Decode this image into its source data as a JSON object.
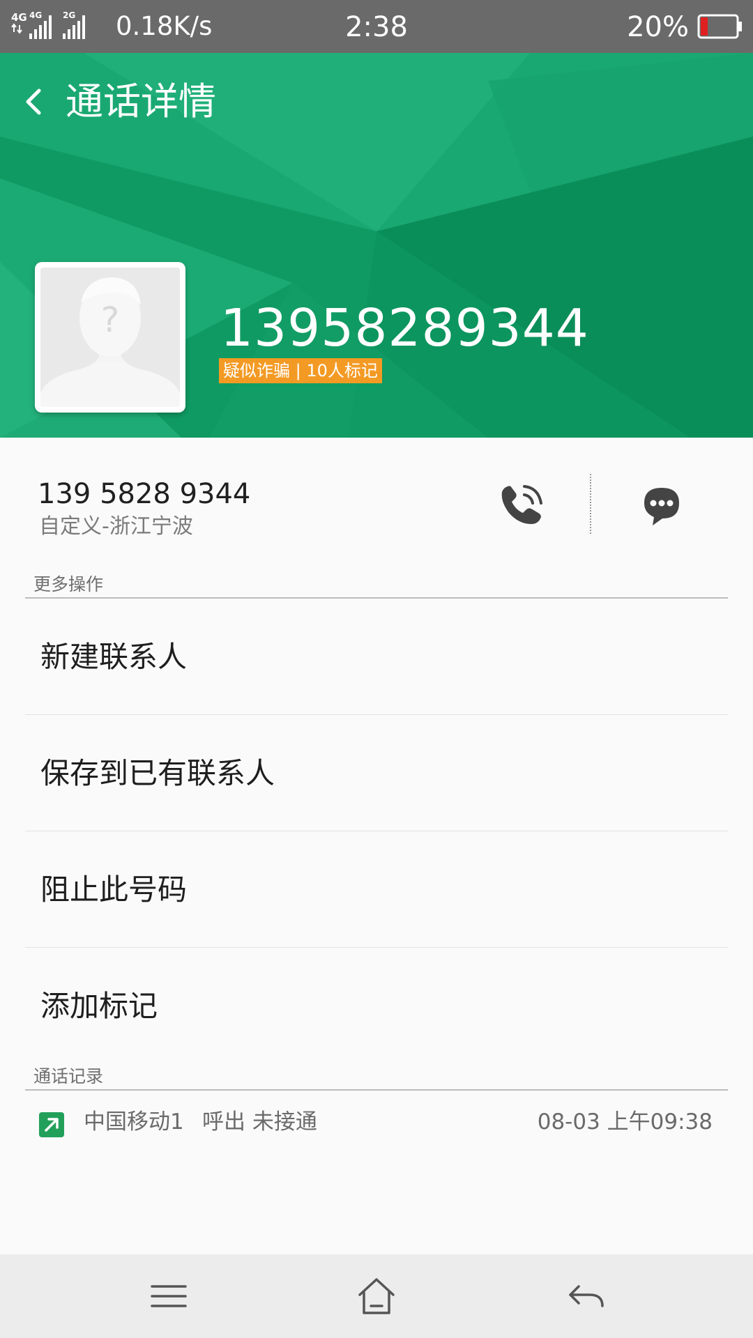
{
  "status_bar": {
    "network_1": "4G",
    "network_2": "4G",
    "network_3": "2G",
    "speed": "0.18K/s",
    "time": "2:38",
    "battery_percent": "20%",
    "battery_level": 0.2,
    "battery_color": "#e02020"
  },
  "header": {
    "title": "通话详情",
    "phone_number": "13958289344",
    "tag": "疑似诈骗 | 10人标记",
    "bg_color": "#0f9a62",
    "tag_color": "#f39a24"
  },
  "number_row": {
    "formatted_number": "139 5828 9344",
    "location": "自定义-浙江宁波",
    "call_icon": "phone-call-icon",
    "message_icon": "chat-bubble-icon"
  },
  "more_actions": {
    "label": "更多操作",
    "items": [
      {
        "label": "新建联系人"
      },
      {
        "label": "保存到已有联系人"
      },
      {
        "label": "阻止此号码"
      },
      {
        "label": "添加标记"
      }
    ]
  },
  "call_log": {
    "label": "通话记录",
    "entries": [
      {
        "icon": "outgoing-call-icon",
        "carrier": "中国移动1",
        "status": "呼出 未接通",
        "time": "08-03 上午09:38"
      }
    ]
  },
  "nav_bar": {
    "menu_icon": "menu-icon",
    "home_icon": "home-icon",
    "back_icon": "back-arrow-icon"
  }
}
